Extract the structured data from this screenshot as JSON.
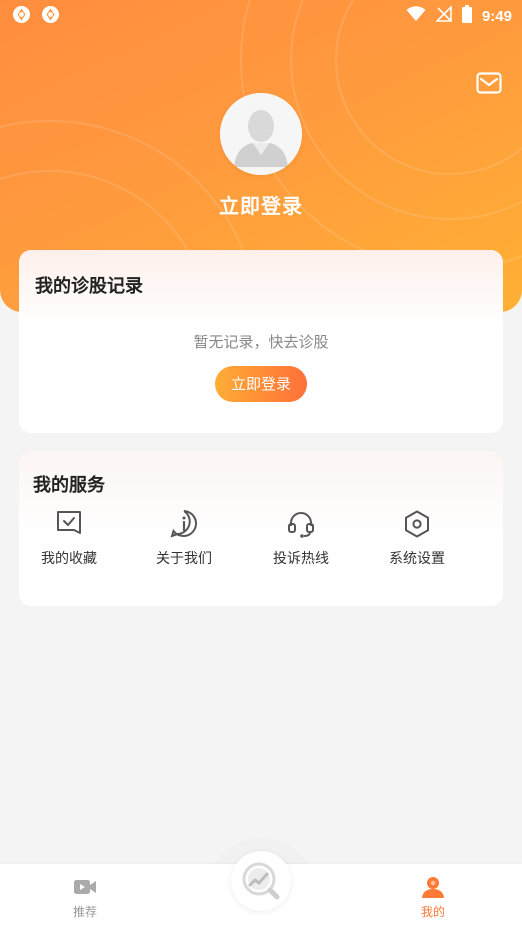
{
  "status_bar": {
    "time": "9:49",
    "left_icons": [
      "app-notification-icon",
      "app-notification-icon"
    ],
    "right_icons": [
      "wifi-icon",
      "no-signal-icon",
      "battery-icon"
    ]
  },
  "header": {
    "login_title": "立即登录",
    "mail_icon": "mail-icon",
    "avatar_icon": "default-avatar-icon"
  },
  "record_card": {
    "title": "我的诊股记录",
    "empty_text": "暂无记录，快去诊股",
    "login_button": "立即登录"
  },
  "service_card": {
    "title": "我的服务",
    "items": [
      {
        "label": "我的收藏",
        "icon": "favorites-icon"
      },
      {
        "label": "关于我们",
        "icon": "info-icon"
      },
      {
        "label": "投诉热线",
        "icon": "headset-icon"
      },
      {
        "label": "系统设置",
        "icon": "settings-icon"
      }
    ]
  },
  "tab_bar": {
    "tabs": [
      {
        "label": "推荐",
        "icon": "video-icon",
        "active": false
      },
      {
        "label": "我的",
        "icon": "user-icon",
        "active": true
      }
    ],
    "center_icon": "stock-diagnosis-icon"
  },
  "colors": {
    "accent": "#ff7a37",
    "gradient_start": "#ff8d3f",
    "gradient_end": "#ffb034",
    "inactive_tab": "#999999"
  }
}
